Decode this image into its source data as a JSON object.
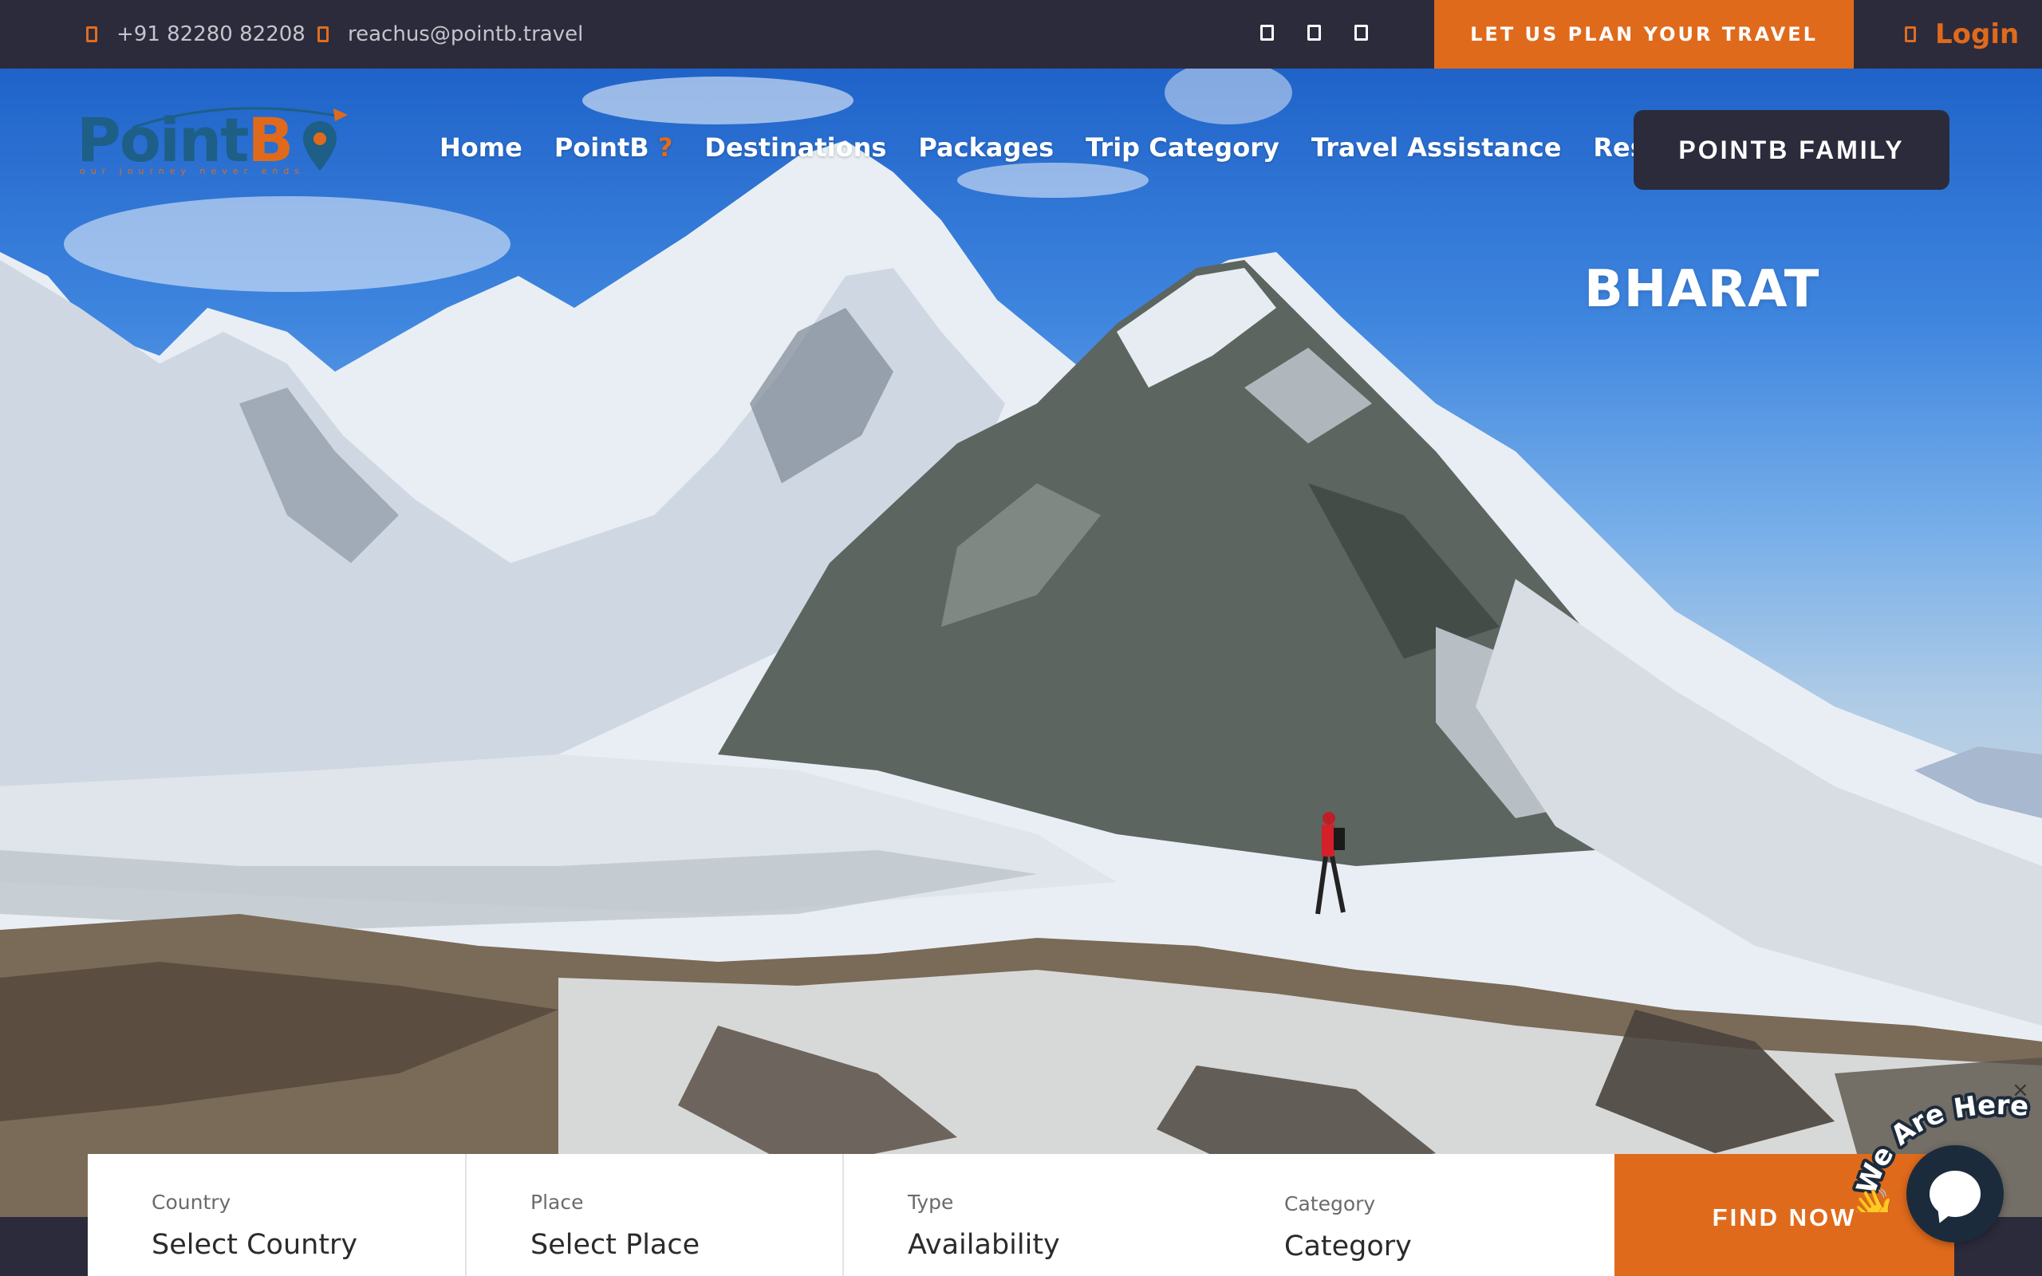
{
  "topbar": {
    "phone": "+91 82280 82208",
    "phone_icon": "phone-icon",
    "email": "reachus@pointb.travel",
    "email_icon": "email-icon",
    "social_icons": [
      "facebook-icon",
      "instagram-icon",
      "linkedin-icon"
    ],
    "plan_label": "LET US PLAN YOUR TRAVEL",
    "login_label": "Login",
    "login_icon": "user-icon"
  },
  "brand": {
    "name_a": "Point",
    "name_b": "B",
    "tagline": "our journey never ends",
    "primary_color": "#1d5f86",
    "accent_color": "#e06a1c",
    "dark_color": "#2c2b3c"
  },
  "nav": {
    "items": [
      {
        "label": "Home"
      },
      {
        "label": "PointB",
        "suffix": "?"
      },
      {
        "label": "Destinations"
      },
      {
        "label": "Packages"
      },
      {
        "label": "Trip Category"
      },
      {
        "label": "Travel Assistance"
      },
      {
        "label": "Resources"
      }
    ],
    "family_label": "POINTB FAMILY"
  },
  "hero": {
    "overlay_text": "BHARAT"
  },
  "search": {
    "fields": [
      {
        "label": "Country",
        "value": "Select Country"
      },
      {
        "label": "Place",
        "value": "Select Place"
      },
      {
        "label": "Type",
        "value": "Availability"
      },
      {
        "label": "Category",
        "value": "Category"
      }
    ],
    "button_label": "FIND NOW"
  },
  "chat": {
    "tag_text": "We Are Here!",
    "close_label": "×"
  }
}
